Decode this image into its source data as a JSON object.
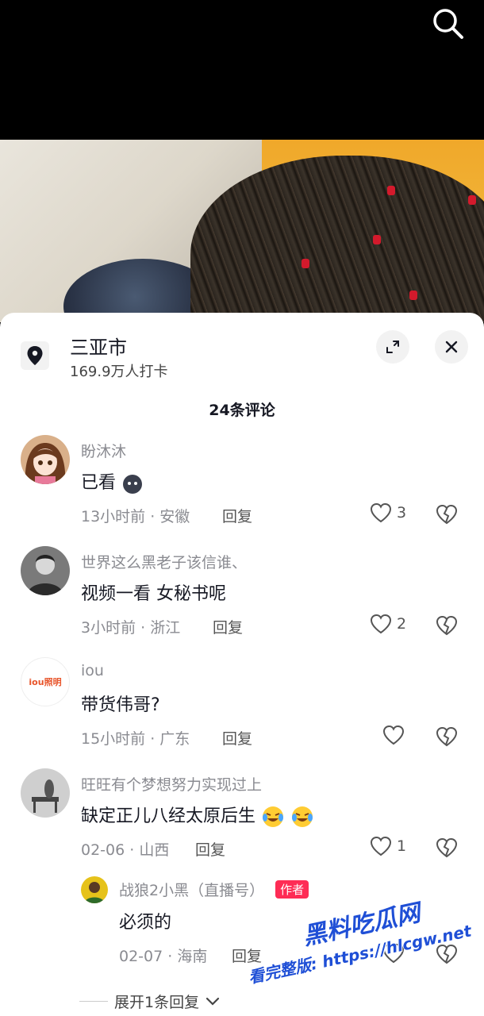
{
  "location": {
    "name": "三亚市",
    "checkins": "169.9万人打卡"
  },
  "comments_header": {
    "count_label": "24条评论"
  },
  "comments": [
    {
      "name": "盼沐沐",
      "text": "已看",
      "time": "13小时前 · 安徽",
      "reply": "回复",
      "likes": "3"
    },
    {
      "name": "世界这么黑老子该信谁、",
      "text": "视频一看 女秘书呢",
      "time": "3小时前 · 浙江",
      "reply": "回复",
      "likes": "2"
    },
    {
      "name": "iou",
      "text": "带货伟哥?",
      "time": "15小时前 · 广东",
      "reply": "回复",
      "likes": "",
      "avatar_text": "iou照明"
    },
    {
      "name": "旺旺有个梦想努力实现过上",
      "text": "缺定正儿八经太原后生",
      "time": "02-06 · 山西",
      "reply": "回复",
      "likes": "1"
    }
  ],
  "reply_comment": {
    "name": "战狼2小黑（直播号）",
    "badge": "作者",
    "text": "必须的",
    "time": "02-07 · 海南",
    "reply": "回复"
  },
  "expand": {
    "label": "展开1条回复"
  },
  "watermark": {
    "line1": "黑料吃瓜网",
    "line2": "看完整版: https://hlcgw.net"
  },
  "icons": {
    "search": "search-icon",
    "location": "location-pin-icon",
    "expand": "expand-icon",
    "close": "close-icon",
    "like": "heart-icon",
    "dislike": "broken-heart-icon"
  },
  "colors": {
    "author_badge": "#fe2c55",
    "watermark": "#1f4fd6"
  }
}
